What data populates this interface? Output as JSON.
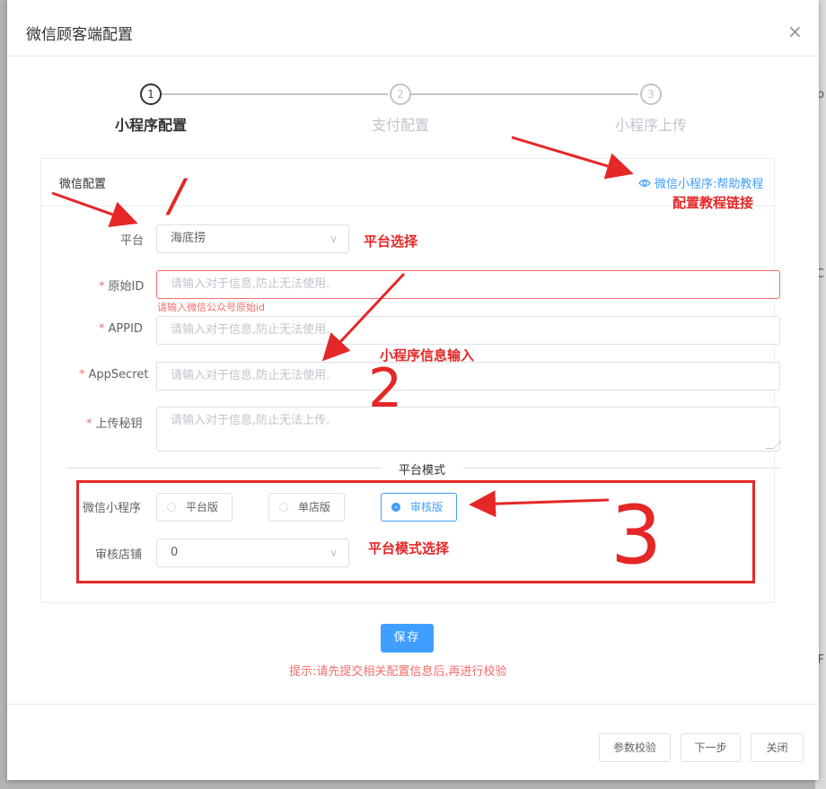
{
  "dialog": {
    "title": "微信顾客端配置",
    "close_icon": "×"
  },
  "steps": [
    {
      "number": "1",
      "label": "小程序配置",
      "active": true
    },
    {
      "number": "2",
      "label": "支付配置",
      "active": false
    },
    {
      "number": "3",
      "label": "小程序上传",
      "active": false
    }
  ],
  "card": {
    "title": "微信配置",
    "help_link": "微信小程序:帮助教程"
  },
  "form": {
    "platform": {
      "label": "平台",
      "value": "海底捞"
    },
    "original_id": {
      "label": "原始ID",
      "placeholder": "请输入对于信息,防止无法使用.",
      "error": "请输入微信公众号原始id"
    },
    "appid": {
      "label": "APPID",
      "placeholder": "请输入对于信息,防止无法使用."
    },
    "appsecret": {
      "label": "AppSecret",
      "placeholder": "请输入对于信息,防止无法使用."
    },
    "upload_key": {
      "label": "上传秘钥",
      "placeholder": "请输入对于信息,防止无法上传."
    },
    "required_mark": "*"
  },
  "platform_mode": {
    "divider": "平台模式",
    "mini_label": "微信小程序",
    "options": [
      "平台版",
      "单店版",
      "审核版"
    ],
    "selected": "审核版",
    "store_label": "审核店铺",
    "store_value": "0"
  },
  "actions": {
    "save": "保存",
    "tip": "提示:请先提交相关配置信息后,再进行校验",
    "verify": "参数校验",
    "next": "下一步",
    "close": "关闭"
  },
  "annotations": {
    "tutorial_link": "配置教程链接",
    "platform_select": "平台选择",
    "info_input": "小程序信息输入",
    "mode_select": "平台模式选择",
    "num1": "/",
    "num2": "2",
    "num3": "3"
  },
  "background_fragments": [
    "p",
    "C",
    "F"
  ],
  "colors": {
    "primary": "#409eff",
    "danger": "#f56c6c",
    "annotation": "#e52727"
  }
}
